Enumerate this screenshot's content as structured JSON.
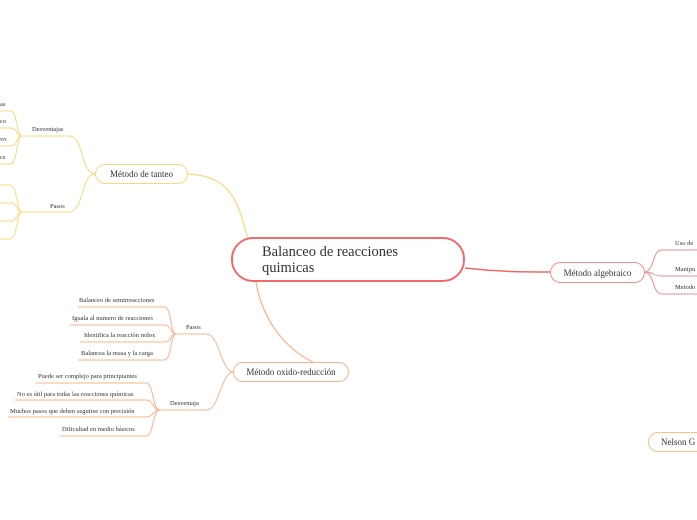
{
  "central": {
    "title": "Balanceo de reacciones quimicas"
  },
  "tanteo": {
    "label": "Método de tanteo",
    "desventajas_label": "Desventajas",
    "desventajas_items": [
      "as",
      "co",
      "vo",
      "cs"
    ],
    "pasos_label": "Pasos"
  },
  "redox": {
    "label": "Método oxido-reducción",
    "pasos_label": "Pasos",
    "pasos_items": [
      "Balanceo de semirreacciones",
      "Iguala al numero de reacciones",
      "Identifica la reacción redox",
      "Balancea la masa y la carga"
    ],
    "desventaja_label": "Desventaja",
    "desventaja_items": [
      "Puede ser complejo para principiantes",
      "No es útil para todas las reacciones químicas",
      "Muchos pasos que deben seguirse con precisión",
      "Dificultad en medio básicos"
    ]
  },
  "algebraico": {
    "label": "Método algebraico",
    "items": [
      "Uso de",
      "Manipu",
      "Metodo"
    ]
  },
  "nelson": {
    "label": "Nelson G"
  },
  "colors": {
    "central": "#ef6b6b",
    "tanteo": "#f8d880",
    "redox": "#f7b48e",
    "algebraico": "#ef8b8b",
    "nelson": "#f7c08e"
  }
}
